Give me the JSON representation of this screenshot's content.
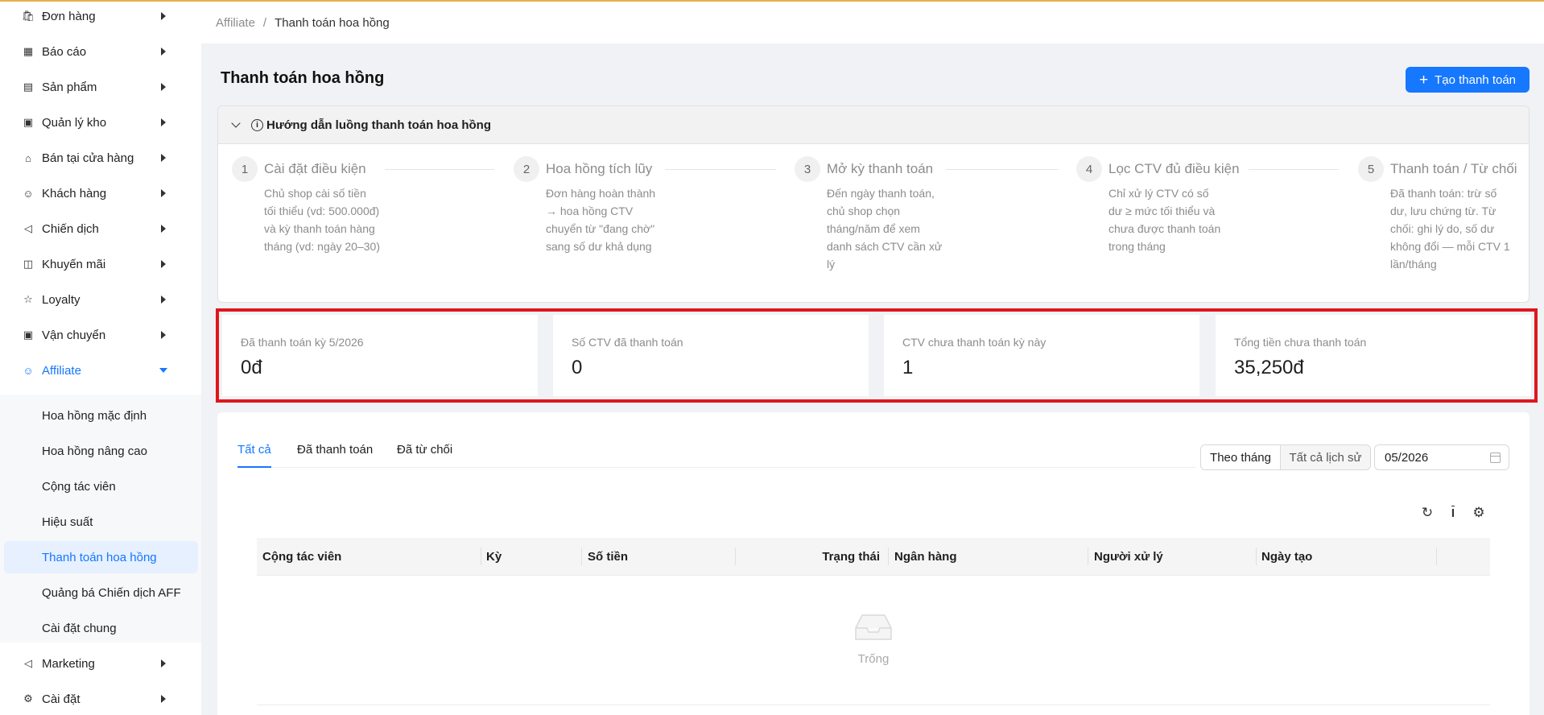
{
  "sidebar": {
    "items": [
      {
        "label": "Đơn hàng",
        "icon": "bag-icon"
      },
      {
        "label": "Báo cáo",
        "icon": "chart-icon"
      },
      {
        "label": "Sản phẩm",
        "icon": "list-icon"
      },
      {
        "label": "Quản lý kho",
        "icon": "box-icon"
      },
      {
        "label": "Bán tại cửa hàng",
        "icon": "shop-icon"
      },
      {
        "label": "Khách hàng",
        "icon": "user-icon"
      },
      {
        "label": "Chiến dịch",
        "icon": "megaphone-icon"
      },
      {
        "label": "Khuyến mãi",
        "icon": "gift-icon"
      },
      {
        "label": "Loyalty",
        "icon": "star-icon"
      },
      {
        "label": "Vận chuyển",
        "icon": "car-icon"
      },
      {
        "label": "Affiliate",
        "icon": "affiliate-icon"
      }
    ],
    "submenu": [
      "Hoa hồng mặc định",
      "Hoa hồng nâng cao",
      "Cộng tác viên",
      "Hiệu suất",
      "Thanh toán hoa hồng",
      "Quảng bá Chiến dịch AFF",
      "Cài đặt chung"
    ],
    "bottom_items": [
      {
        "label": "Marketing",
        "icon": "megaphone-icon"
      },
      {
        "label": "Cài đặt",
        "icon": "gear-icon"
      }
    ]
  },
  "breadcrumb": {
    "parent": "Affiliate",
    "separator": "/",
    "current": "Thanh toán hoa hồng"
  },
  "header": {
    "title": "Thanh toán hoa hồng",
    "create_button": "Tạo thanh toán"
  },
  "guide": {
    "title": "Hướng dẫn luồng thanh toán hoa hồng",
    "steps": [
      {
        "num": "1",
        "title": "Cài đặt điều kiện",
        "desc": "Chủ shop cài số tiền tối thiểu (vd: 500.000đ) và kỳ thanh toán hàng tháng (vd: ngày 20–30)"
      },
      {
        "num": "2",
        "title": "Hoa hồng tích lũy",
        "desc": "Đơn hàng hoàn thành → hoa hồng CTV chuyển từ \"đang chờ\" sang số dư khả dụng"
      },
      {
        "num": "3",
        "title": "Mở kỳ thanh toán",
        "desc": "Đến ngày thanh toán, chủ shop chọn tháng/năm để xem danh sách CTV cần xử lý"
      },
      {
        "num": "4",
        "title": "Lọc CTV đủ điều kiện",
        "desc": "Chỉ xử lý CTV có số dư ≥ mức tối thiểu và chưa được thanh toán trong tháng"
      },
      {
        "num": "5",
        "title": "Thanh toán / Từ chối",
        "desc": "Đã thanh toán: trừ số dư, lưu chứng từ. Từ chối: ghi lý do, số dư không đổi — mỗi CTV 1 lần/tháng"
      }
    ]
  },
  "stats": [
    {
      "label": "Đã thanh toán kỳ 5/2026",
      "value": "0đ"
    },
    {
      "label": "Số CTV đã thanh toán",
      "value": "0"
    },
    {
      "label": "CTV chưa thanh toán kỳ này",
      "value": "1"
    },
    {
      "label": "Tổng tiền chưa thanh toán",
      "value": "35,250đ"
    }
  ],
  "tabs": [
    "Tất cả",
    "Đã thanh toán",
    "Đã từ chối"
  ],
  "view_toggle": {
    "selected": "Theo tháng",
    "other": "Tất cả lịch sử"
  },
  "date_picker": {
    "value": "05/2026"
  },
  "table": {
    "columns": [
      "Cộng tác viên",
      "Kỳ",
      "Số tiền",
      "Trạng thái",
      "Ngân hàng",
      "Người xử lý",
      "Ngày tạo"
    ],
    "empty_text": "Trống"
  },
  "colors": {
    "accent": "#1677ff",
    "highlight_border": "#e0161d"
  }
}
